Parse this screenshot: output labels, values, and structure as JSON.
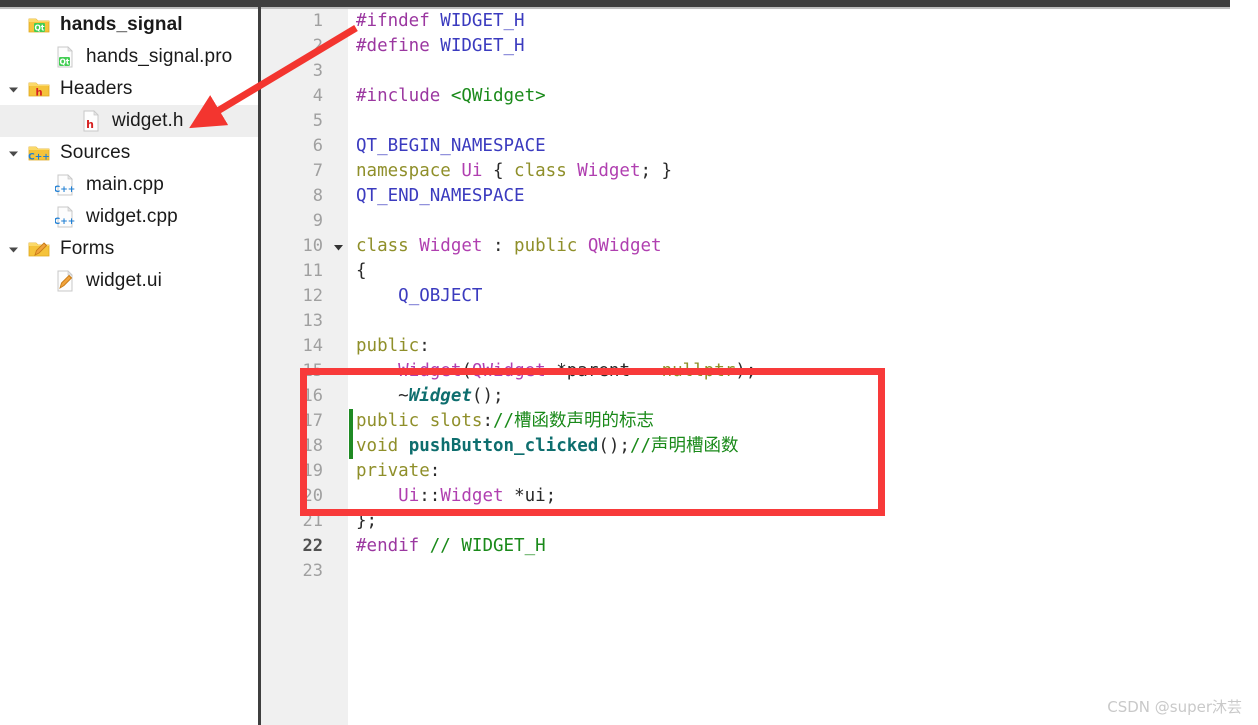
{
  "window": {
    "topbar_color": "#3f3f3f",
    "divider_color": "#3f3f3f"
  },
  "sidebar": {
    "items": [
      {
        "label": "hands_signal",
        "icon": "qt-folder-icon",
        "indent": 0,
        "twisty": "none",
        "bold": true,
        "selected": false
      },
      {
        "label": "hands_signal.pro",
        "icon": "qt-file-icon",
        "indent": 1,
        "twisty": "none",
        "bold": false,
        "selected": false
      },
      {
        "label": "Headers",
        "icon": "h-folder-icon",
        "indent": 0,
        "twisty": "expanded",
        "bold": false,
        "selected": false
      },
      {
        "label": "widget.h",
        "icon": "h-file-icon",
        "indent": 2,
        "twisty": "none",
        "bold": false,
        "selected": true
      },
      {
        "label": "Sources",
        "icon": "cpp-folder-icon",
        "indent": 0,
        "twisty": "expanded",
        "bold": false,
        "selected": false
      },
      {
        "label": "main.cpp",
        "icon": "cpp-file-icon",
        "indent": 1,
        "twisty": "none",
        "bold": false,
        "selected": false
      },
      {
        "label": "widget.cpp",
        "icon": "cpp-file-icon",
        "indent": 1,
        "twisty": "none",
        "bold": false,
        "selected": false
      },
      {
        "label": "Forms",
        "icon": "ui-folder-icon",
        "indent": 0,
        "twisty": "expanded",
        "bold": false,
        "selected": false
      },
      {
        "label": "widget.ui",
        "icon": "ui-file-icon",
        "indent": 1,
        "twisty": "none",
        "bold": false,
        "selected": false
      }
    ]
  },
  "editor": {
    "filename": "widget.h",
    "current_line": 22,
    "change_bar_lines": [
      17,
      18
    ],
    "fold_marker_line": 10,
    "lines": [
      {
        "n": 1,
        "tokens": [
          {
            "t": "#ifndef ",
            "c": "s-pre"
          },
          {
            "t": "WIDGET_H",
            "c": "s-macro"
          }
        ]
      },
      {
        "n": 2,
        "tokens": [
          {
            "t": "#define ",
            "c": "s-pre"
          },
          {
            "t": "WIDGET_H",
            "c": "s-macro"
          }
        ]
      },
      {
        "n": 3,
        "tokens": []
      },
      {
        "n": 4,
        "tokens": [
          {
            "t": "#include ",
            "c": "s-pre"
          },
          {
            "t": "<QWidget>",
            "c": "s-str"
          }
        ]
      },
      {
        "n": 5,
        "tokens": []
      },
      {
        "n": 6,
        "tokens": [
          {
            "t": "QT_BEGIN_NAMESPACE",
            "c": "s-macro"
          }
        ]
      },
      {
        "n": 7,
        "tokens": [
          {
            "t": "namespace ",
            "c": "s-kw"
          },
          {
            "t": "Ui",
            "c": "s-type"
          },
          {
            "t": " { ",
            "c": "s-punc"
          },
          {
            "t": "class ",
            "c": "s-kw"
          },
          {
            "t": "Widget",
            "c": "s-type"
          },
          {
            "t": "; }",
            "c": "s-punc"
          }
        ]
      },
      {
        "n": 8,
        "tokens": [
          {
            "t": "QT_END_NAMESPACE",
            "c": "s-macro"
          }
        ]
      },
      {
        "n": 9,
        "tokens": []
      },
      {
        "n": 10,
        "tokens": [
          {
            "t": "class ",
            "c": "s-kw"
          },
          {
            "t": "Widget",
            "c": "s-type"
          },
          {
            "t": " : ",
            "c": "s-punc"
          },
          {
            "t": "public ",
            "c": "s-kw"
          },
          {
            "t": "QWidget",
            "c": "s-type"
          }
        ]
      },
      {
        "n": 11,
        "tokens": [
          {
            "t": "{",
            "c": "s-punc"
          }
        ]
      },
      {
        "n": 12,
        "tokens": [
          {
            "t": "    ",
            "c": "s-txt"
          },
          {
            "t": "Q_OBJECT",
            "c": "s-macro"
          }
        ]
      },
      {
        "n": 13,
        "tokens": []
      },
      {
        "n": 14,
        "tokens": [
          {
            "t": "public",
            "c": "s-kw"
          },
          {
            "t": ":",
            "c": "s-punc"
          }
        ]
      },
      {
        "n": 15,
        "tokens": [
          {
            "t": "    ",
            "c": "s-txt"
          },
          {
            "t": "Widget",
            "c": "s-type"
          },
          {
            "t": "(",
            "c": "s-punc"
          },
          {
            "t": "QWidget",
            "c": "s-type"
          },
          {
            "t": " *parent = ",
            "c": "s-punc"
          },
          {
            "t": "nullptr",
            "c": "s-kw"
          },
          {
            "t": ");",
            "c": "s-punc"
          }
        ]
      },
      {
        "n": 16,
        "tokens": [
          {
            "t": "    ~",
            "c": "s-punc"
          },
          {
            "t": "Widget",
            "c": "s-dtor"
          },
          {
            "t": "();",
            "c": "s-punc"
          }
        ]
      },
      {
        "n": 17,
        "tokens": [
          {
            "t": "public slots",
            "c": "s-kw"
          },
          {
            "t": ":",
            "c": "s-punc"
          },
          {
            "t": "//槽函数声明的标志",
            "c": "s-cmt"
          }
        ]
      },
      {
        "n": 18,
        "tokens": [
          {
            "t": "void ",
            "c": "s-kw"
          },
          {
            "t": "pushButton_clicked",
            "c": "s-fn"
          },
          {
            "t": "();",
            "c": "s-punc"
          },
          {
            "t": "//声明槽函数",
            "c": "s-cmt"
          }
        ]
      },
      {
        "n": 19,
        "tokens": [
          {
            "t": "private",
            "c": "s-kw"
          },
          {
            "t": ":",
            "c": "s-punc"
          }
        ]
      },
      {
        "n": 20,
        "tokens": [
          {
            "t": "    ",
            "c": "s-txt"
          },
          {
            "t": "Ui",
            "c": "s-type"
          },
          {
            "t": "::",
            "c": "s-punc"
          },
          {
            "t": "Widget",
            "c": "s-type"
          },
          {
            "t": " *ui;",
            "c": "s-punc"
          }
        ]
      },
      {
        "n": 21,
        "tokens": [
          {
            "t": "};",
            "c": "s-punc"
          }
        ]
      },
      {
        "n": 22,
        "tokens": [
          {
            "t": "#endif ",
            "c": "s-pre"
          },
          {
            "t": "// WIDGET_H",
            "c": "s-cmt"
          }
        ]
      },
      {
        "n": 23,
        "tokens": []
      }
    ]
  },
  "annotations": {
    "highlight_box": {
      "color": "#f83a3a",
      "covers_lines": "15-19"
    },
    "arrow": {
      "color": "#f3352f",
      "points_to": "widget.h"
    }
  },
  "watermark": {
    "text": "CSDN @super沐芸"
  }
}
